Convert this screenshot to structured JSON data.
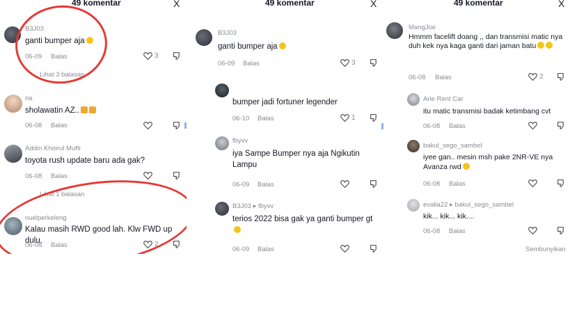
{
  "panels": {
    "p1": {
      "title": "49 komentar",
      "close": "X",
      "comments": [
        {
          "user": "B3J03",
          "text": "ganti bumper aja",
          "date": "06-09",
          "reply": "Balas",
          "likes": "3",
          "view_replies": "Lihat 3 balasan"
        },
        {
          "user": "ria",
          "text": "sholawatin AZ..",
          "date": "06-08",
          "reply": "Balas",
          "likes": ""
        },
        {
          "user": "Addin Khoirul Mufti",
          "text": "toyota rush update baru ada gak?",
          "date": "06-08",
          "reply": "Balas",
          "likes": "",
          "view_replies": "Lihat 1 balasan"
        },
        {
          "user": "nuelperkeleng",
          "text": "Kalau masih RWD good lah. Klw FWD up dulu.",
          "date": "06-08",
          "reply": "Balas",
          "likes": "2"
        }
      ]
    },
    "p2": {
      "title": "49 komentar",
      "close": "X",
      "comments": [
        {
          "user": "B3J03",
          "text": "ganti bumper aja",
          "date": "06-09",
          "reply": "Balas",
          "likes": "3"
        },
        {
          "user": "",
          "text": "bumper jadi fortuner legender",
          "date": "06-10",
          "reply": "Balas",
          "likes": "1"
        },
        {
          "user": "fbyvv",
          "text": "iya Sampe Bumper nya aja Ngikutin Lampu",
          "date": "06-09",
          "reply": "Balas",
          "likes": ""
        },
        {
          "user": "B3J03 ▸ fbyvv",
          "text": "terios 2022 bisa gak ya ganti bumper gt",
          "date": "06-09",
          "reply": "Balas",
          "likes": ""
        }
      ]
    },
    "p3": {
      "title": "49 komentar",
      "close": "X",
      "comments": [
        {
          "user": "MangJoe",
          "text": "Hmmm facelift doang ,, dan transmisi matic nya duh kek nya kaga ganti dari jaman batu",
          "date": "06-08",
          "reply": "Balas",
          "likes": "2"
        },
        {
          "user": "Arie Rent Car",
          "text": "itu matic transmisi badak ketimbang cvt",
          "date": "06-08",
          "reply": "Balas",
          "likes": ""
        },
        {
          "user": "bakul_sego_sambel",
          "text": "iyee gan.. mesin msh pake 2NR-VE nya Avanza rwd",
          "date": "06-08",
          "reply": "Balas",
          "likes": ""
        },
        {
          "user": "evalia22 ▸ bakul_sego_sambel",
          "text": "kik... kik... kik....",
          "date": "06-08",
          "reply": "Balas",
          "likes": ""
        }
      ],
      "hide": "Sembunyikan"
    }
  },
  "colors": {
    "text": "#161823",
    "muted": "#8a8b91",
    "highlight": "#e53935",
    "emoji": "#f5c518"
  },
  "icons": [
    "heart-icon",
    "dislike-icon",
    "close-icon",
    "smile-emoji"
  ]
}
